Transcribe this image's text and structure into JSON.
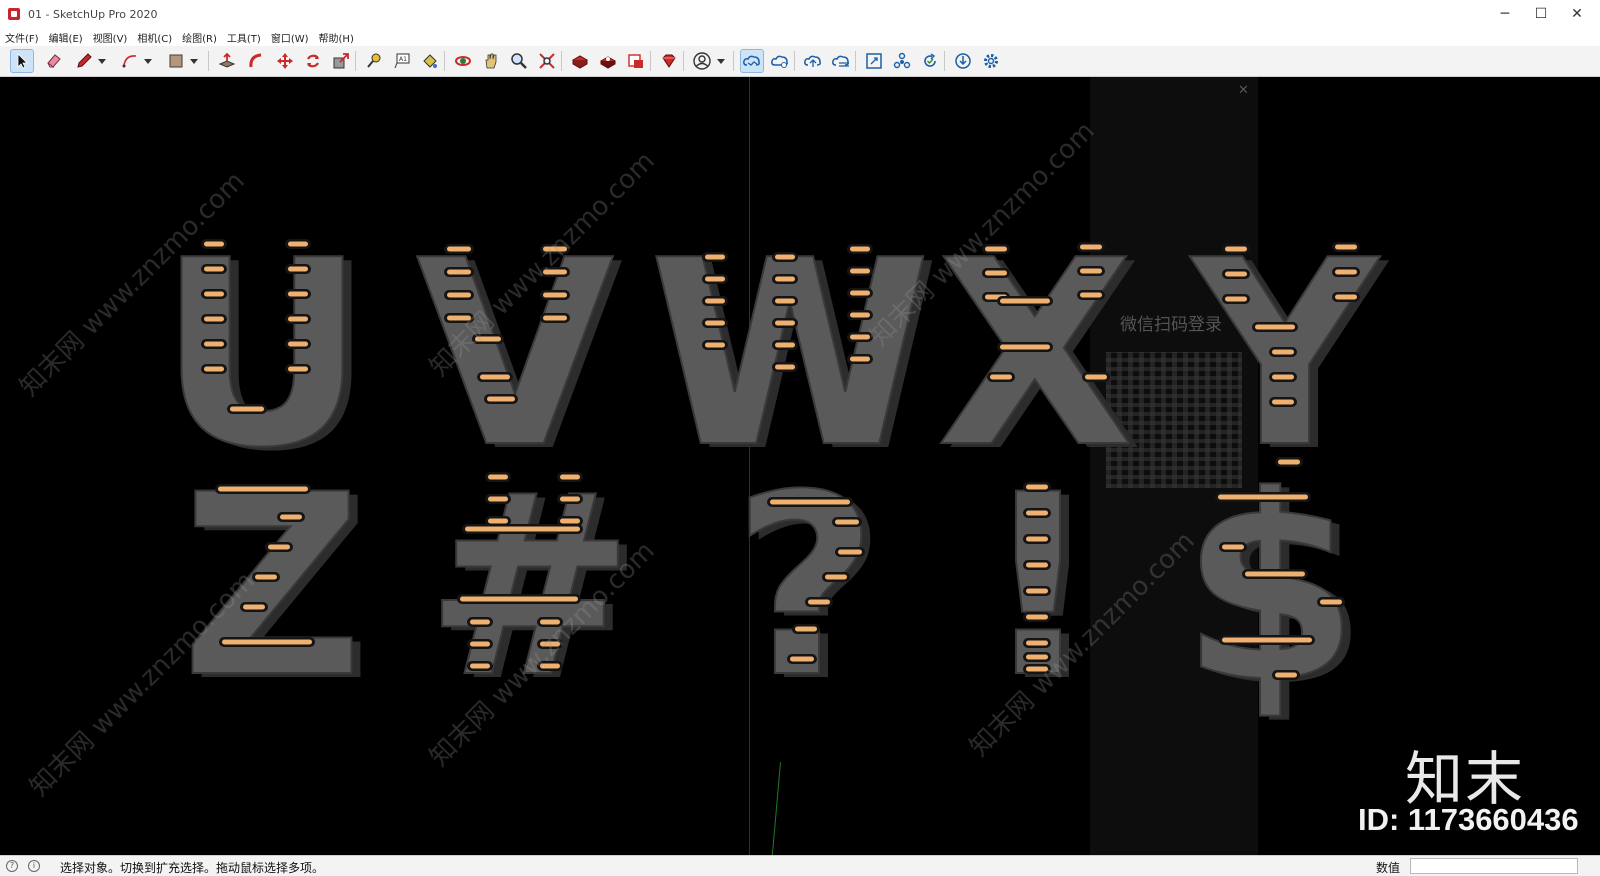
{
  "window": {
    "title": "01 - SketchUp Pro 2020",
    "minimize_glyph": "─",
    "maximize_glyph": "☐",
    "close_glyph": "✕"
  },
  "menu": [
    "文件(F)",
    "编辑(E)",
    "视图(V)",
    "相机(C)",
    "绘图(R)",
    "工具(T)",
    "窗口(W)",
    "帮助(H)"
  ],
  "toolbar": {
    "icons": [
      "select-icon",
      "eraser-icon",
      "pencil-icon",
      "arc-icon",
      "rectangle-icon",
      "push-pull-icon",
      "follow-me-icon",
      "move-icon",
      "rotate-icon",
      "scale-icon",
      "tape-measure-icon",
      "text-icon",
      "paint-bucket-icon",
      "orbit-icon",
      "pan-icon",
      "zoom-icon",
      "zoom-extents-icon",
      "3d-warehouse-icon",
      "extension-warehouse-icon",
      "layout-icon",
      "ruby-icon",
      "account-icon",
      "trimble-connect-icon",
      "cloud-sync-icon",
      "cloud-open-icon",
      "cloud-share-icon",
      "fullscreen-icon",
      "components-icon",
      "reload-icon",
      "download-icon",
      "settings-icon"
    ],
    "active": "select-icon"
  },
  "viewport": {
    "background_color": "#000000",
    "row1_glyphs": [
      "U",
      "V",
      "W",
      "X",
      "Y"
    ],
    "row2_glyphs": [
      "Z",
      "#",
      "?",
      "!",
      "$"
    ],
    "marquee_color": "#5a5a5a",
    "bulb_color": "#f0b070",
    "ghost_login_text": "微信扫码登录",
    "ghost_close": "✕",
    "watermark_text": "知末网 www.znzmo.com",
    "brand_text": "知末",
    "id_text": "ID: 1173660436"
  },
  "status": {
    "message": "选择对象。切换到扩充选择。拖动鼠标选择多项。",
    "measurements_label": "数值",
    "measurements_value": ""
  }
}
